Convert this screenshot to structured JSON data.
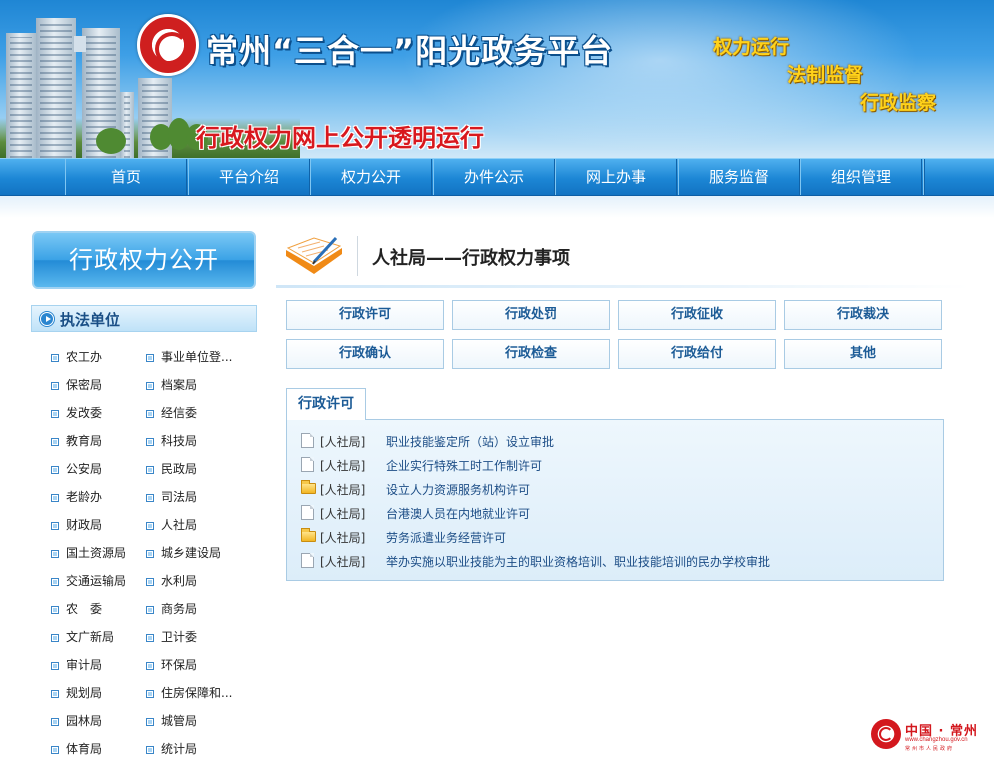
{
  "header": {
    "site_title": "常州“三合一”阳光政务平台",
    "slogans": [
      "权力运行",
      "法制监督",
      "行政监察"
    ],
    "tagline": "行政权力网上公开透明运行"
  },
  "nav": {
    "items": [
      {
        "label": "首页"
      },
      {
        "label": "平台介绍"
      },
      {
        "label": "权力公开"
      },
      {
        "label": "办件公示"
      },
      {
        "label": "网上办事"
      },
      {
        "label": "服务监督"
      },
      {
        "label": "组织管理"
      }
    ]
  },
  "sidebar": {
    "title": "行政权力公开",
    "section_title": "执法单位",
    "units": [
      [
        "农工办",
        "事业单位登..."
      ],
      [
        "保密局",
        "档案局"
      ],
      [
        "发改委",
        "经信委"
      ],
      [
        "教育局",
        "科技局"
      ],
      [
        "公安局",
        "民政局"
      ],
      [
        "老龄办",
        "司法局"
      ],
      [
        "财政局",
        "人社局"
      ],
      [
        "国土资源局",
        "城乡建设局"
      ],
      [
        "交通运输局",
        "水利局"
      ],
      [
        "农　委",
        "商务局"
      ],
      [
        "文广新局",
        "卫计委"
      ],
      [
        "审计局",
        "环保局"
      ],
      [
        "规划局",
        "住房保障和..."
      ],
      [
        "园林局",
        "城管局"
      ],
      [
        "体育局",
        "统计局"
      ]
    ]
  },
  "main": {
    "title": "人社局——行政权力事项",
    "categories": [
      [
        "行政许可",
        "行政处罚",
        "行政征收",
        "行政裁决"
      ],
      [
        "行政确认",
        "行政检查",
        "行政给付",
        "其他"
      ]
    ],
    "active_tab": "行政许可",
    "items": [
      {
        "icon": "document",
        "tag": "[人社局]",
        "title": "职业技能鉴定所（站）设立审批"
      },
      {
        "icon": "document",
        "tag": "[人社局]",
        "title": "企业实行特殊工时工作制许可"
      },
      {
        "icon": "folder",
        "tag": "[人社局]",
        "title": "设立人力资源服务机构许可"
      },
      {
        "icon": "document",
        "tag": "[人社局]",
        "title": "台港澳人员在内地就业许可"
      },
      {
        "icon": "folder",
        "tag": "[人社局]",
        "title": "劳务派遣业务经营许可"
      },
      {
        "icon": "document",
        "tag": "[人社局]",
        "title": "举办实施以职业技能为主的职业资格培训、职业技能培训的民办学校审批"
      }
    ]
  },
  "footer": {
    "name": "中国 · 常州",
    "url": "www.changzhou.gov.cn",
    "org": "常州市人民政府"
  },
  "colors": {
    "nav_blue": "#1c86d5",
    "title_red": "#d8181e",
    "slogan_yellow": "#ffd21a",
    "link_blue": "#1c4d86"
  }
}
